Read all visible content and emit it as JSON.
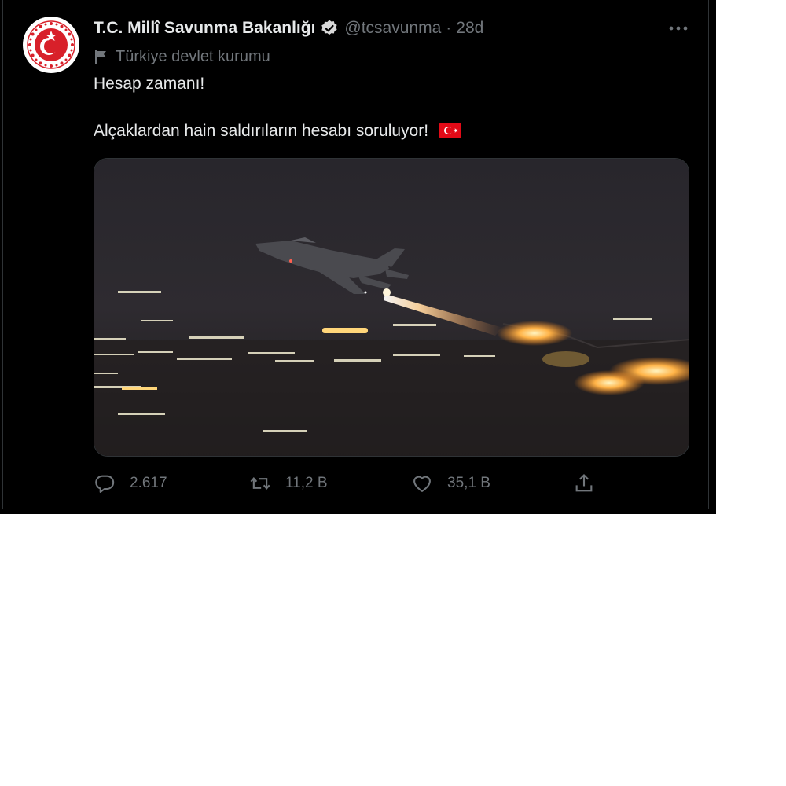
{
  "tweet": {
    "author": {
      "display_name": "T.C. Millî Savunma Bakanlığı",
      "handle": "@tcsavunma",
      "verified": true
    },
    "separator": "·",
    "time": "28d",
    "label": "Türkiye devlet kurumu",
    "text_line_1": "Hesap zamanı!",
    "text_line_2": "Alçaklardan hain saldırıların hesabı soruluyor!",
    "media_description_icon": "jet-night-photo",
    "actions": {
      "reply_count": "2.617",
      "retweet_count": "11,2 B",
      "like_count": "35,1 B"
    }
  },
  "colors": {
    "background": "#000000",
    "text_primary": "#e7e9ea",
    "text_secondary": "#71767b",
    "border": "#2f3336",
    "verified_badge": "#d9d9d9",
    "flag_red": "#e30a17"
  },
  "icons": {
    "more": "more-horizontal-icon",
    "label": "flag-icon",
    "reply": "reply-icon",
    "retweet": "retweet-icon",
    "like": "heart-icon",
    "share": "share-icon"
  }
}
